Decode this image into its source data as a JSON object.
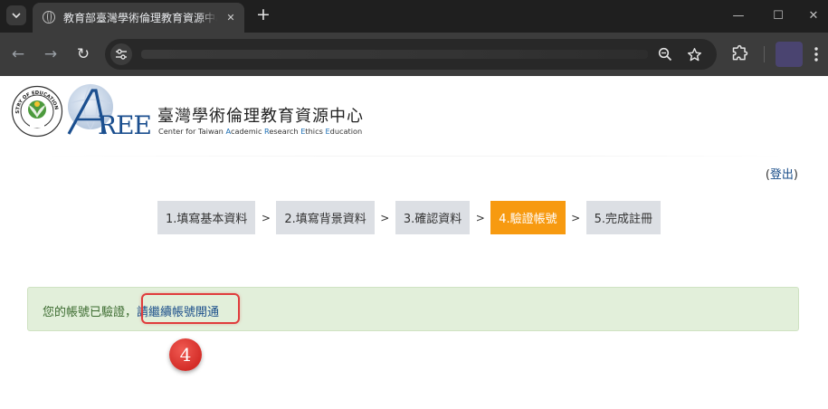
{
  "browser": {
    "tab_title": "教育部臺灣學術倫理教育資源中心",
    "tab_close": "✕",
    "new_tab": "+",
    "win_minimize": "—",
    "win_maximize": "☐",
    "win_close": "✕",
    "back": "←",
    "forward": "→",
    "reload": "↻",
    "url": ""
  },
  "header": {
    "moe_logo_text": "MINISTRY OF EDUCATION 教育部",
    "aree_logo_text": "AREE",
    "org_name_zh": "臺灣學術倫理教育資源中心",
    "org_name_en": [
      "Center for Taiwan ",
      "A",
      "cademic ",
      "R",
      "esearch ",
      "E",
      "thics ",
      "E",
      "ducation"
    ]
  },
  "logout": {
    "open": "(",
    "label": "登出",
    "close": ")"
  },
  "steps": [
    {
      "label": "1.填寫基本資料",
      "active": false
    },
    {
      "label": "2.填寫背景資料",
      "active": false
    },
    {
      "label": "3.確認資料",
      "active": false
    },
    {
      "label": "4.驗證帳號",
      "active": true
    },
    {
      "label": "5.完成註冊",
      "active": false
    }
  ],
  "step_separator": ">",
  "alert": {
    "message": "您的帳號已驗證，",
    "link_text": "請繼續帳號開通"
  },
  "annotation": {
    "marker_number": "4"
  },
  "colors": {
    "accent": "#f79a10",
    "step_bg": "#dcdfe4",
    "alert_bg": "#e2efda",
    "highlight": "#e03c3c"
  }
}
